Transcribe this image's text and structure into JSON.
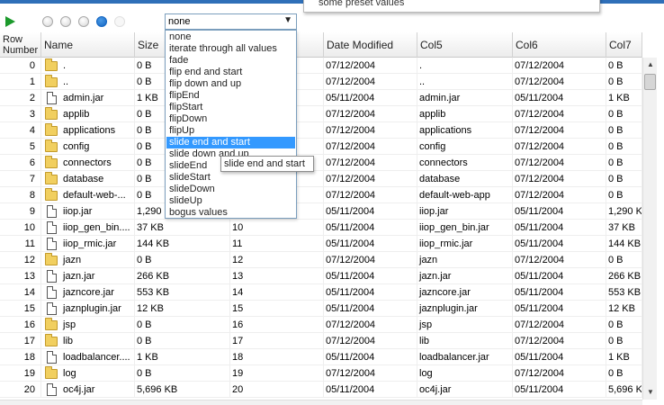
{
  "toolbar": {
    "play_icon": "play-icon",
    "dots": [
      {
        "name": "dot-1",
        "state": "inactive"
      },
      {
        "name": "dot-2",
        "state": "inactive"
      },
      {
        "name": "dot-3",
        "state": "inactive"
      },
      {
        "name": "dot-4",
        "state": "active"
      },
      {
        "name": "dot-5",
        "state": "faint"
      }
    ],
    "transition_select": {
      "value": "none",
      "arrow": "▼"
    },
    "tooltip_top": "some preset values"
  },
  "grid": {
    "headers": [
      "Row Number",
      "Name",
      "Size",
      "",
      "Date Modified",
      "Col5",
      "Col6",
      "Col7"
    ],
    "rows": [
      {
        "num": "0",
        "icon": "folder",
        "name": ".",
        "size": "0 B",
        "c3": "",
        "date": "07/12/2004",
        "col5": ".",
        "col6": "07/12/2004",
        "col7": "0 B"
      },
      {
        "num": "1",
        "icon": "folder",
        "name": "..",
        "size": "0 B",
        "c3": "",
        "date": "07/12/2004",
        "col5": "..",
        "col6": "07/12/2004",
        "col7": "0 B"
      },
      {
        "num": "2",
        "icon": "file",
        "name": "admin.jar",
        "size": "1 KB",
        "c3": "",
        "date": "05/11/2004",
        "col5": "admin.jar",
        "col6": "05/11/2004",
        "col7": "1 KB"
      },
      {
        "num": "3",
        "icon": "folder",
        "name": "applib",
        "size": "0 B",
        "c3": "",
        "date": "07/12/2004",
        "col5": "applib",
        "col6": "07/12/2004",
        "col7": "0 B"
      },
      {
        "num": "4",
        "icon": "folder",
        "name": "applications",
        "size": "0 B",
        "c3": "",
        "date": "07/12/2004",
        "col5": "applications",
        "col6": "07/12/2004",
        "col7": "0 B"
      },
      {
        "num": "5",
        "icon": "folder",
        "name": "config",
        "size": "0 B",
        "c3": "",
        "date": "07/12/2004",
        "col5": "config",
        "col6": "07/12/2004",
        "col7": "0 B"
      },
      {
        "num": "6",
        "icon": "folder",
        "name": "connectors",
        "size": "0 B",
        "c3": "",
        "date": "07/12/2004",
        "col5": "connectors",
        "col6": "07/12/2004",
        "col7": "0 B"
      },
      {
        "num": "7",
        "icon": "folder",
        "name": "database",
        "size": "0 B",
        "c3": "",
        "date": "07/12/2004",
        "col5": "database",
        "col6": "07/12/2004",
        "col7": "0 B"
      },
      {
        "num": "8",
        "icon": "folder",
        "name": "default-web-...",
        "size": "0 B",
        "c3": "",
        "date": "07/12/2004",
        "col5": "default-web-app",
        "col6": "07/12/2004",
        "col7": "0 B"
      },
      {
        "num": "9",
        "icon": "file",
        "name": "iiop.jar",
        "size": "1,290",
        "c3": "",
        "date": "05/11/2004",
        "col5": "iiop.jar",
        "col6": "05/11/2004",
        "col7": "1,290 K"
      },
      {
        "num": "10",
        "icon": "file",
        "name": "iiop_gen_bin....",
        "size": "37 KB",
        "c3": "10",
        "date": "05/11/2004",
        "col5": "iiop_gen_bin.jar",
        "col6": "05/11/2004",
        "col7": "37 KB"
      },
      {
        "num": "11",
        "icon": "file",
        "name": "iiop_rmic.jar",
        "size": "144 KB",
        "c3": "11",
        "date": "05/11/2004",
        "col5": "iiop_rmic.jar",
        "col6": "05/11/2004",
        "col7": "144 KB"
      },
      {
        "num": "12",
        "icon": "folder",
        "name": "jazn",
        "size": "0 B",
        "c3": "12",
        "date": "07/12/2004",
        "col5": "jazn",
        "col6": "07/12/2004",
        "col7": "0 B"
      },
      {
        "num": "13",
        "icon": "file",
        "name": "jazn.jar",
        "size": "266 KB",
        "c3": "13",
        "date": "05/11/2004",
        "col5": "jazn.jar",
        "col6": "05/11/2004",
        "col7": "266 KB"
      },
      {
        "num": "14",
        "icon": "file",
        "name": "jazncore.jar",
        "size": "553 KB",
        "c3": "14",
        "date": "05/11/2004",
        "col5": "jazncore.jar",
        "col6": "05/11/2004",
        "col7": "553 KB"
      },
      {
        "num": "15",
        "icon": "file",
        "name": "jaznplugin.jar",
        "size": "12 KB",
        "c3": "15",
        "date": "05/11/2004",
        "col5": "jaznplugin.jar",
        "col6": "05/11/2004",
        "col7": "12 KB"
      },
      {
        "num": "16",
        "icon": "folder",
        "name": "jsp",
        "size": "0 B",
        "c3": "16",
        "date": "07/12/2004",
        "col5": "jsp",
        "col6": "07/12/2004",
        "col7": "0 B"
      },
      {
        "num": "17",
        "icon": "folder",
        "name": "lib",
        "size": "0 B",
        "c3": "17",
        "date": "07/12/2004",
        "col5": "lib",
        "col6": "07/12/2004",
        "col7": "0 B"
      },
      {
        "num": "18",
        "icon": "file",
        "name": "loadbalancer....",
        "size": "1 KB",
        "c3": "18",
        "date": "05/11/2004",
        "col5": "loadbalancer.jar",
        "col6": "05/11/2004",
        "col7": "1 KB"
      },
      {
        "num": "19",
        "icon": "folder",
        "name": "log",
        "size": "0 B",
        "c3": "19",
        "date": "07/12/2004",
        "col5": "log",
        "col6": "07/12/2004",
        "col7": "0 B"
      },
      {
        "num": "20",
        "icon": "file",
        "name": "oc4j.jar",
        "size": "5,696 KB",
        "c3": "20",
        "date": "05/11/2004",
        "col5": "oc4j.jar",
        "col6": "05/11/2004",
        "col7": "5,696 K"
      }
    ]
  },
  "dropdown": {
    "options": [
      "none",
      "iterate through all values",
      "fade",
      "flip end and start",
      "flip down and up",
      "flipEnd",
      "flipStart",
      "flipDown",
      "flipUp",
      "slide end and start",
      "slide down and up",
      "slideEnd",
      "slideStart",
      "slideDown",
      "slideUp",
      "bogus values"
    ],
    "selected_index": 9,
    "hover_tooltip": "slide end and start"
  },
  "colors": {
    "accent": "#2f6fb8",
    "selection": "#3399ff",
    "play": "#1c9a2c"
  }
}
